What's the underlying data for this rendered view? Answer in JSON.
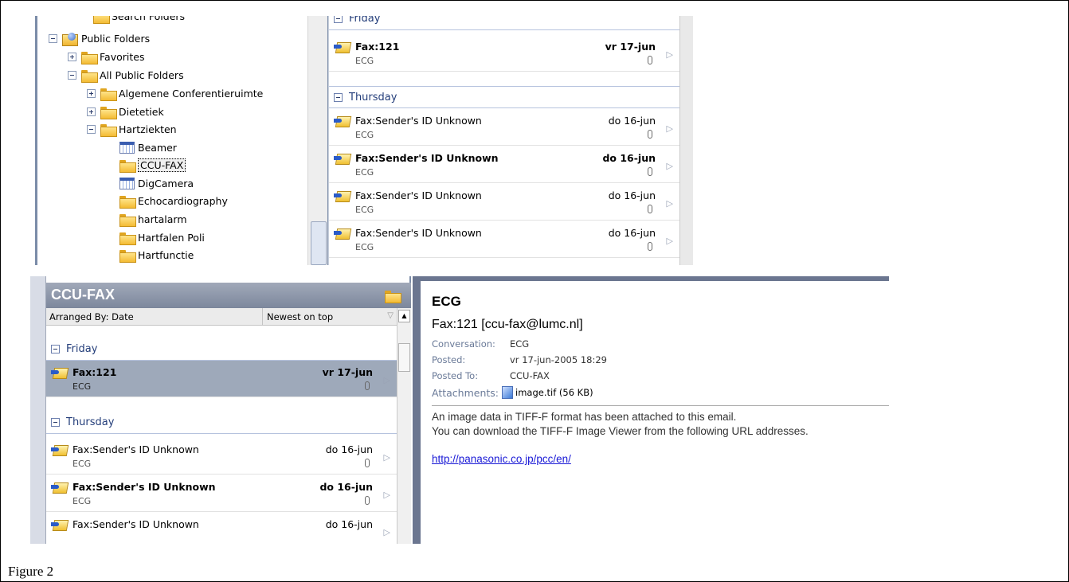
{
  "caption": "Figure 2",
  "tree": {
    "search_folders": "Search Folders",
    "public_folders": "Public Folders",
    "favorites": "Favorites",
    "all_public_folders": "All Public Folders",
    "conferentie": "Algemene Conferentieruimte",
    "dietetiek": "Dietetiek",
    "hartziekten": "Hartziekten",
    "beamer": "Beamer",
    "ccu_fax": "CCU-FAX",
    "digcamera": "DigCamera",
    "echo": "Echocardiography",
    "hartalarm": "hartalarm",
    "hartfalen": "Hartfalen Poli",
    "hartfunctie": "Hartfunctie"
  },
  "top_list": {
    "friday": "Friday",
    "thursday": "Thursday",
    "messages": [
      {
        "subject": "Fax:121",
        "from": "ECG",
        "date": "vr 17-jun"
      },
      {
        "subject": "Fax:Sender's ID Unknown",
        "from": "ECG",
        "date": "do 16-jun"
      },
      {
        "subject": "Fax:Sender's ID Unknown",
        "from": "ECG",
        "date": "do 16-jun"
      },
      {
        "subject": "Fax:Sender's ID Unknown",
        "from": "ECG",
        "date": "do 16-jun"
      },
      {
        "subject": "Fax:Sender's ID Unknown",
        "from": "ECG",
        "date": "do 16-jun"
      }
    ]
  },
  "list": {
    "folder_title": "CCU-FAX",
    "arranged_by": "Arranged By: Date",
    "sort_order": "Newest on top",
    "friday": "Friday",
    "thursday": "Thursday",
    "messages": [
      {
        "subject": "Fax:121",
        "from": "ECG",
        "date": "vr 17-jun"
      },
      {
        "subject": "Fax:Sender's ID Unknown",
        "from": "ECG",
        "date": "do 16-jun"
      },
      {
        "subject": "Fax:Sender's ID Unknown",
        "from": "ECG",
        "date": "do 16-jun"
      },
      {
        "subject": "Fax:Sender's ID Unknown",
        "from": "",
        "date": "do 16-jun"
      }
    ]
  },
  "reading": {
    "subject": "ECG",
    "from": "Fax:121 [ccu-fax@lumc.nl]",
    "conversation_label": "Conversation:",
    "conversation": "ECG",
    "posted_label": "Posted:",
    "posted": "vr 17-jun-2005 18:29",
    "posted_to_label": "Posted To:",
    "posted_to": "CCU-FAX",
    "attachments_label": "Attachments:",
    "attachment": "image.tif (56 KB)",
    "body_line1": "An image data in TIFF-F format has been attached to this email.",
    "body_line2": "You can download the TIFF-F Image Viewer from the following URL addresses.",
    "link": "http://panasonic.co.jp/pcc/en/"
  }
}
